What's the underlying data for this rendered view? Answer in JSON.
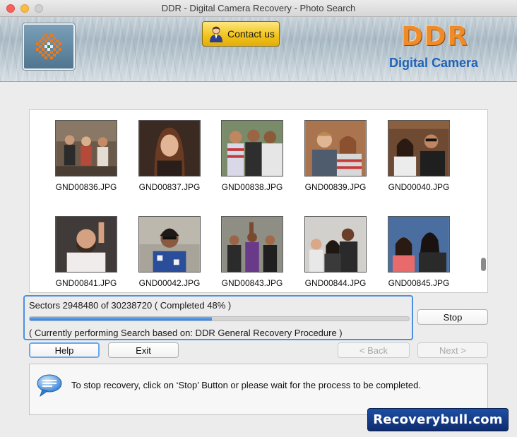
{
  "window": {
    "title": "DDR - Digital Camera Recovery - Photo Search"
  },
  "header": {
    "contact_label": "Contact us",
    "brand_title": "DDR",
    "brand_subtitle": "Digital Camera"
  },
  "files": [
    {
      "name": "GND00836.JPG"
    },
    {
      "name": "GND00837.JPG"
    },
    {
      "name": "GND00838.JPG"
    },
    {
      "name": "GND00839.JPG"
    },
    {
      "name": "GND00040.JPG"
    },
    {
      "name": "GND00841.JPG"
    },
    {
      "name": "GND00042.JPG"
    },
    {
      "name": "GND00843.JPG"
    },
    {
      "name": "GND00844.JPG"
    },
    {
      "name": "GND00845.JPG"
    }
  ],
  "progress": {
    "sectors_text": "Sectors 2948480 of 30238720   ( Completed 48% )",
    "completed_fraction": 0.48,
    "status_text": "( Currently performing Search based on: DDR General Recovery Procedure )"
  },
  "buttons": {
    "stop": "Stop",
    "help": "Help",
    "exit": "Exit",
    "back": "< Back",
    "next": "Next >"
  },
  "info": {
    "message": "To stop recovery, click on ‘Stop’ Button or please wait for the process to be completed."
  },
  "watermark": {
    "text": "Recoverybull.com"
  },
  "colors": {
    "accent": "#4a90e2",
    "brand_orange": "#f08b2a",
    "brand_blue": "#1f63b8"
  }
}
